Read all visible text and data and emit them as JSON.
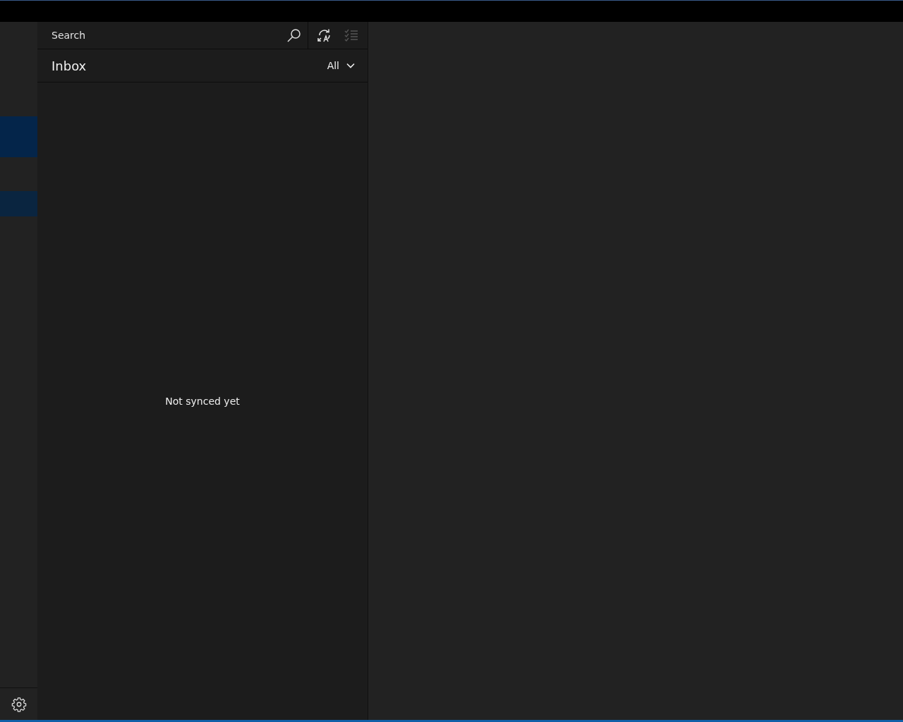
{
  "sidebar": {
    "items": [
      {
        "selected": true
      },
      {
        "selected": false
      }
    ]
  },
  "search": {
    "placeholder": "Search"
  },
  "toolbar": [
    {
      "kind": "sync",
      "disabled": false
    },
    {
      "kind": "select",
      "disabled": true
    }
  ],
  "folder": {
    "title": "Inbox",
    "filter": "All"
  },
  "message_list": {
    "empty_text": "Not synced yet"
  }
}
